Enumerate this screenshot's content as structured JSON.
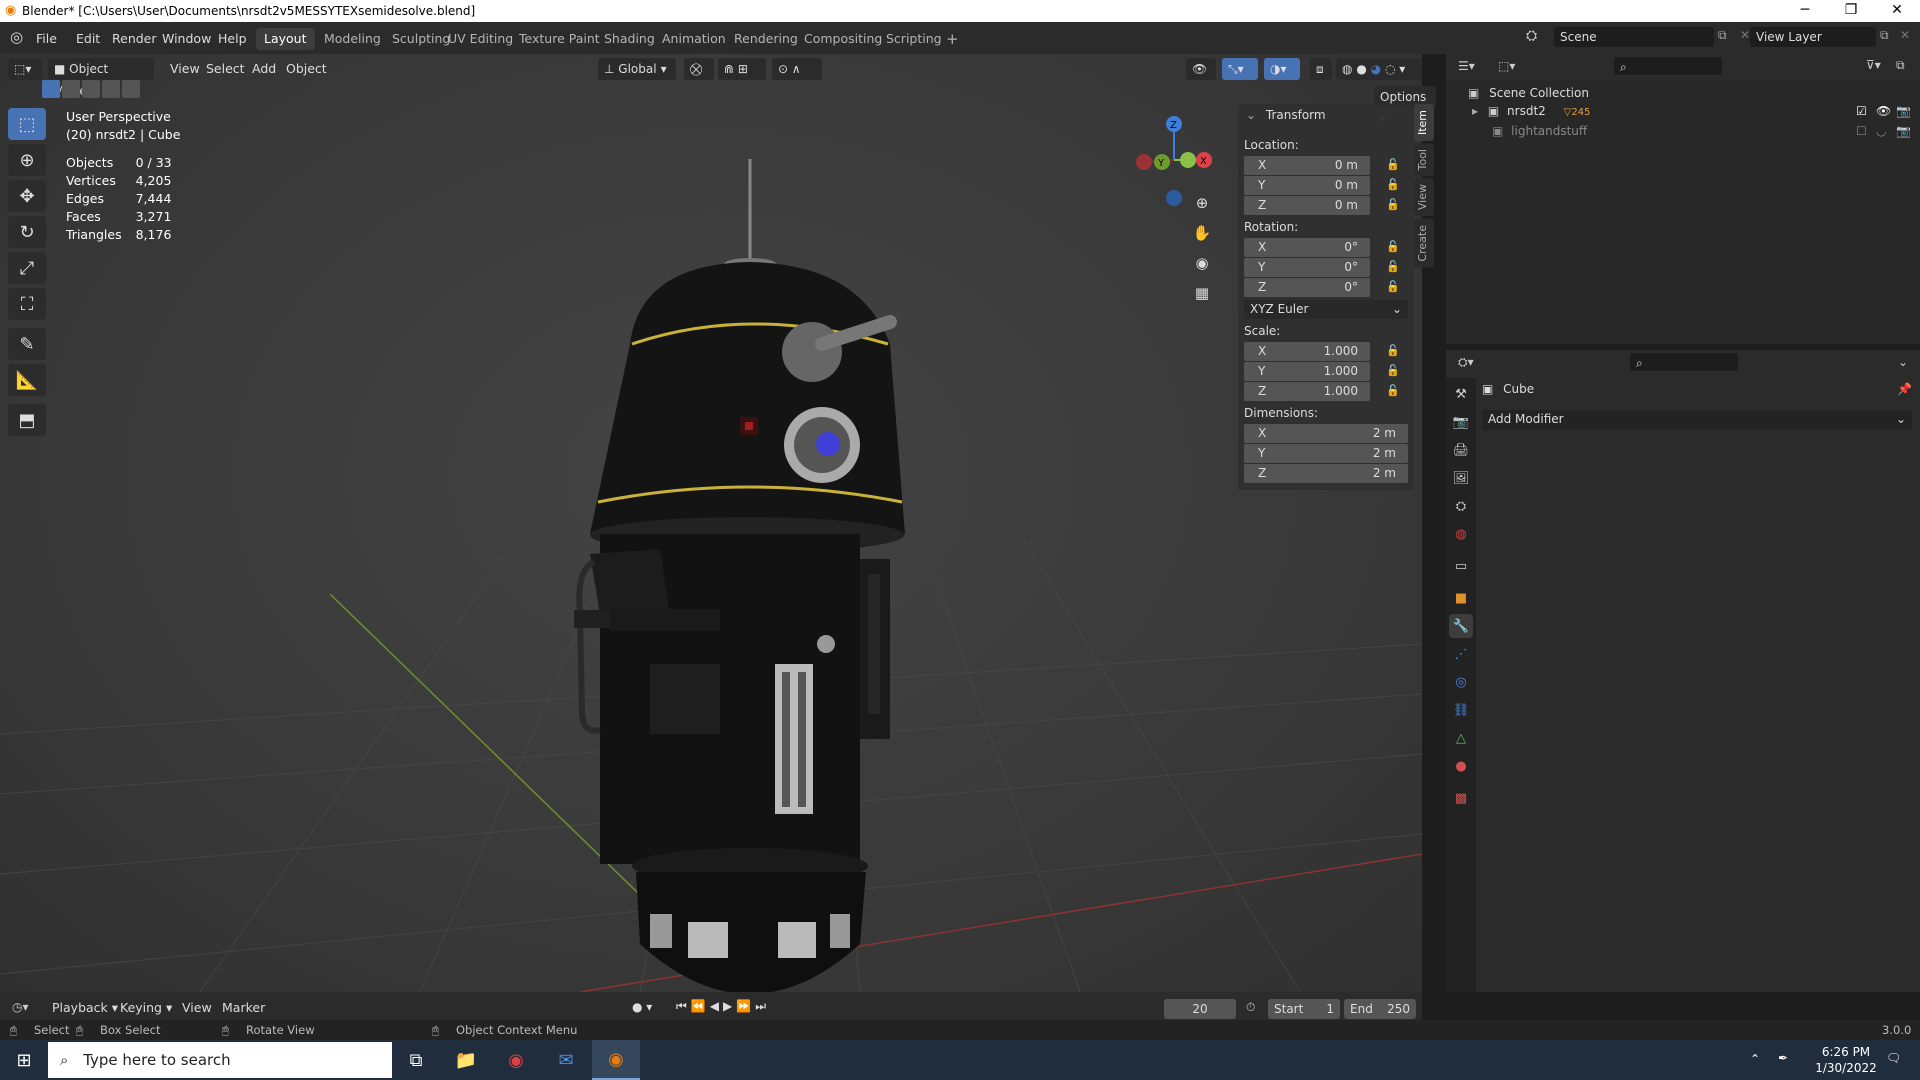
{
  "window": {
    "title": "Blender* [C:\\Users\\User\\Documents\\nrsdt2v5MESSYTEXsemidesolve.blend]",
    "minimize": "─",
    "restore": "❐",
    "close": "✕"
  },
  "menus": [
    "File",
    "Edit",
    "Render",
    "Window",
    "Help"
  ],
  "workspace_tabs": [
    "Layout",
    "Modeling",
    "Sculpting",
    "UV Editing",
    "Texture Paint",
    "Shading",
    "Animation",
    "Rendering",
    "Compositing",
    "Scripting"
  ],
  "add_tab": "+",
  "scene": {
    "label": "Scene",
    "view_layer": "View Layer"
  },
  "viewport_header": {
    "mode": "Object Mode",
    "menus": [
      "View",
      "Select",
      "Add",
      "Object"
    ],
    "orientation": "Global",
    "options": "Options"
  },
  "overlay_info": {
    "perspective": "User Perspective",
    "object": "(20) nrsdt2 | Cube",
    "stats": [
      {
        "label": "Objects",
        "value": "0 / 33"
      },
      {
        "label": "Vertices",
        "value": "4,205"
      },
      {
        "label": "Edges",
        "value": "7,444"
      },
      {
        "label": "Faces",
        "value": "3,271"
      },
      {
        "label": "Triangles",
        "value": "8,176"
      }
    ]
  },
  "gizmo": {
    "x": "X",
    "y": "Y",
    "z": "Z"
  },
  "transform": {
    "title": "Transform",
    "location_label": "Location:",
    "location": [
      {
        "axis": "X",
        "value": "0 m"
      },
      {
        "axis": "Y",
        "value": "0 m"
      },
      {
        "axis": "Z",
        "value": "0 m"
      }
    ],
    "rotation_label": "Rotation:",
    "rotation": [
      {
        "axis": "X",
        "value": "0°"
      },
      {
        "axis": "Y",
        "value": "0°"
      },
      {
        "axis": "Z",
        "value": "0°"
      }
    ],
    "rotation_mode": "XYZ Euler",
    "scale_label": "Scale:",
    "scale": [
      {
        "axis": "X",
        "value": "1.000"
      },
      {
        "axis": "Y",
        "value": "1.000"
      },
      {
        "axis": "Z",
        "value": "1.000"
      }
    ],
    "dimensions_label": "Dimensions:",
    "dimensions": [
      {
        "axis": "X",
        "value": "2 m"
      },
      {
        "axis": "Y",
        "value": "2 m"
      },
      {
        "axis": "Z",
        "value": "2 m"
      }
    ]
  },
  "side_tabs": [
    "Item",
    "Tool",
    "View",
    "Create"
  ],
  "outliner": {
    "root": "Scene Collection",
    "items": [
      {
        "name": "nrsdt2",
        "badge": "24",
        "badge2": "5"
      },
      {
        "name": "lightandstuff"
      }
    ]
  },
  "properties": {
    "object_name": "Cube",
    "add_modifier": "Add Modifier"
  },
  "timeline": {
    "menus": [
      "Playback",
      "Keying",
      "View",
      "Marker"
    ],
    "current_frame": "20",
    "start_label": "Start",
    "start": "1",
    "end_label": "End",
    "end": "250"
  },
  "status": {
    "select": "Select",
    "box_select": "Box Select",
    "rotate_view": "Rotate View",
    "context_menu": "Object Context Menu",
    "version": "3.0.0"
  },
  "taskbar": {
    "search_placeholder": "Type here to search",
    "time": "6:26 PM",
    "date": "1/30/2022"
  },
  "colors": {
    "accent": "#4772b3",
    "x_axis": "#e0404a",
    "y_axis": "#8bc34a",
    "z_axis": "#3d7fdc"
  }
}
